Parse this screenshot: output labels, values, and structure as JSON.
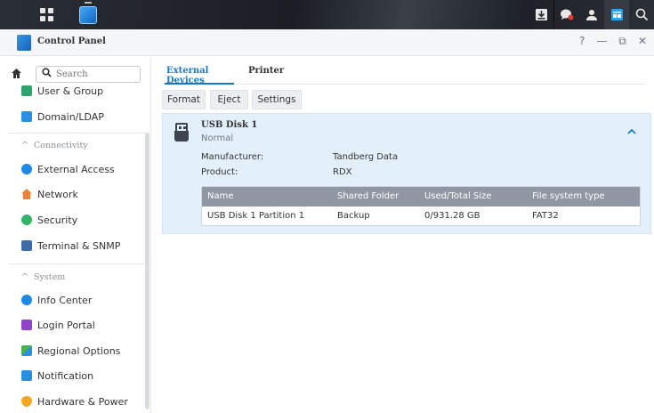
{
  "taskbar": {
    "icons": [
      "main-menu-icon",
      "control-panel-icon",
      "download-tray-icon",
      "notification-icon",
      "user-icon",
      "widgets-icon",
      "search-icon"
    ]
  },
  "window": {
    "title": "Control Panel",
    "controls": {
      "help": "?",
      "minimize": "—",
      "restore": "⧉",
      "close": "✕"
    }
  },
  "sidebar": {
    "search_placeholder": "Search",
    "items_top": [
      {
        "label": "User & Group",
        "icon": "user-group-icon",
        "color": "#2fa36b"
      },
      {
        "label": "Domain/LDAP",
        "icon": "domain-ldap-icon",
        "color": "#2a8fe0"
      }
    ],
    "section_connectivity": "Connectivity",
    "items_connectivity": [
      {
        "label": "External Access",
        "icon": "external-access-icon",
        "color": "#1e88e5"
      },
      {
        "label": "Network",
        "icon": "network-icon",
        "color": "#e8833a"
      },
      {
        "label": "Security",
        "icon": "security-icon",
        "color": "#34b36a"
      },
      {
        "label": "Terminal & SNMP",
        "icon": "terminal-icon",
        "color": "#3d6da8"
      }
    ],
    "section_system": "System",
    "items_system": [
      {
        "label": "Info Center",
        "icon": "info-center-icon",
        "color": "#1e88e5"
      },
      {
        "label": "Login Portal",
        "icon": "login-portal-icon",
        "color": "#8e44c9"
      },
      {
        "label": "Regional Options",
        "icon": "regional-options-icon",
        "color": "#4caf50"
      },
      {
        "label": "Notification",
        "icon": "notification-settings-icon",
        "color": "#2a8fe0"
      },
      {
        "label": "Hardware & Power",
        "icon": "hardware-power-icon",
        "color": "#f5a623"
      }
    ]
  },
  "tabs": [
    {
      "label": "External Devices",
      "active": true
    },
    {
      "label": "Printer",
      "active": false
    }
  ],
  "toolbar": {
    "format": "Format",
    "eject": "Eject",
    "settings": "Settings"
  },
  "device": {
    "name": "USB Disk 1",
    "status": "Normal",
    "manufacturer_label": "Manufacturer:",
    "manufacturer": "Tandberg Data",
    "product_label": "Product:",
    "product": "RDX",
    "table": {
      "columns": [
        "Name",
        "Shared Folder",
        "Used/Total Size",
        "File system type"
      ],
      "rows": [
        [
          "USB Disk 1 Partition 1",
          "Backup",
          "0/931.28 GB",
          "FAT32"
        ]
      ]
    }
  },
  "colors": {
    "accent": "#1a78c2",
    "panel_bg": "#e3f0fb",
    "table_header": "#8e97a2"
  }
}
